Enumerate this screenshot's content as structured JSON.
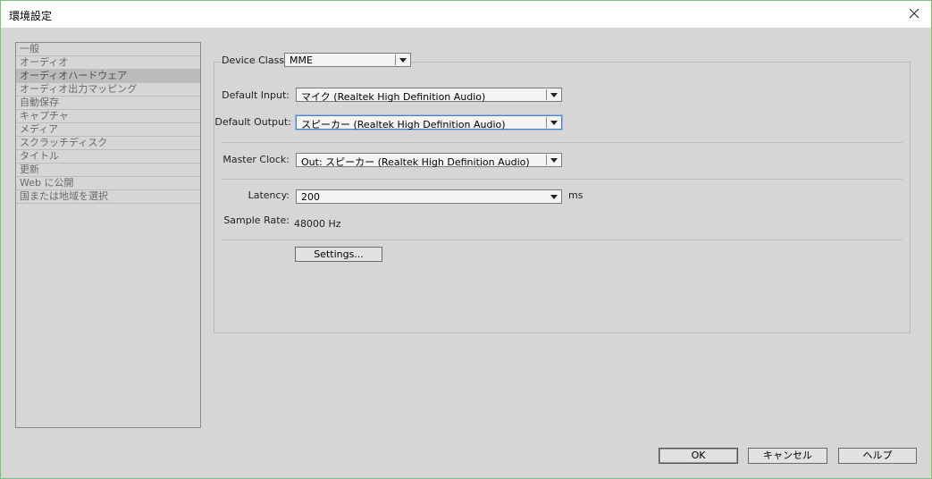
{
  "window": {
    "title": "環境設定"
  },
  "sidebar": {
    "items": [
      {
        "label": "一般"
      },
      {
        "label": "オーディオ"
      },
      {
        "label": "オーディオハードウェア"
      },
      {
        "label": "オーディオ出力マッピング"
      },
      {
        "label": "自動保存"
      },
      {
        "label": "キャプチャ"
      },
      {
        "label": "メディア"
      },
      {
        "label": "スクラッチディスク"
      },
      {
        "label": "タイトル"
      },
      {
        "label": "更新"
      },
      {
        "label": "Web に公開"
      },
      {
        "label": "国または地域を選択"
      }
    ],
    "selected": "オーディオハードウェア"
  },
  "audio_hardware": {
    "device_class_label": "Device Class:",
    "device_class_value": "MME",
    "default_input_label": "Default Input:",
    "default_input_value": "マイク (Realtek High Definition Audio)",
    "default_output_label": "Default Output:",
    "default_output_value": "スピーカー (Realtek High Definition Audio)",
    "master_clock_label": "Master Clock:",
    "master_clock_value": "Out: スピーカー (Realtek High Definition Audio)",
    "latency_label": "Latency:",
    "latency_value": "200",
    "latency_unit": "ms",
    "sample_rate_label": "Sample Rate:",
    "sample_rate_value": "48000 Hz",
    "settings_button": "Settings..."
  },
  "footer": {
    "ok": "OK",
    "cancel": "キャンセル",
    "help": "ヘルプ"
  },
  "icons": {
    "close": "close-icon",
    "dropdown": "chevron-down-icon"
  }
}
